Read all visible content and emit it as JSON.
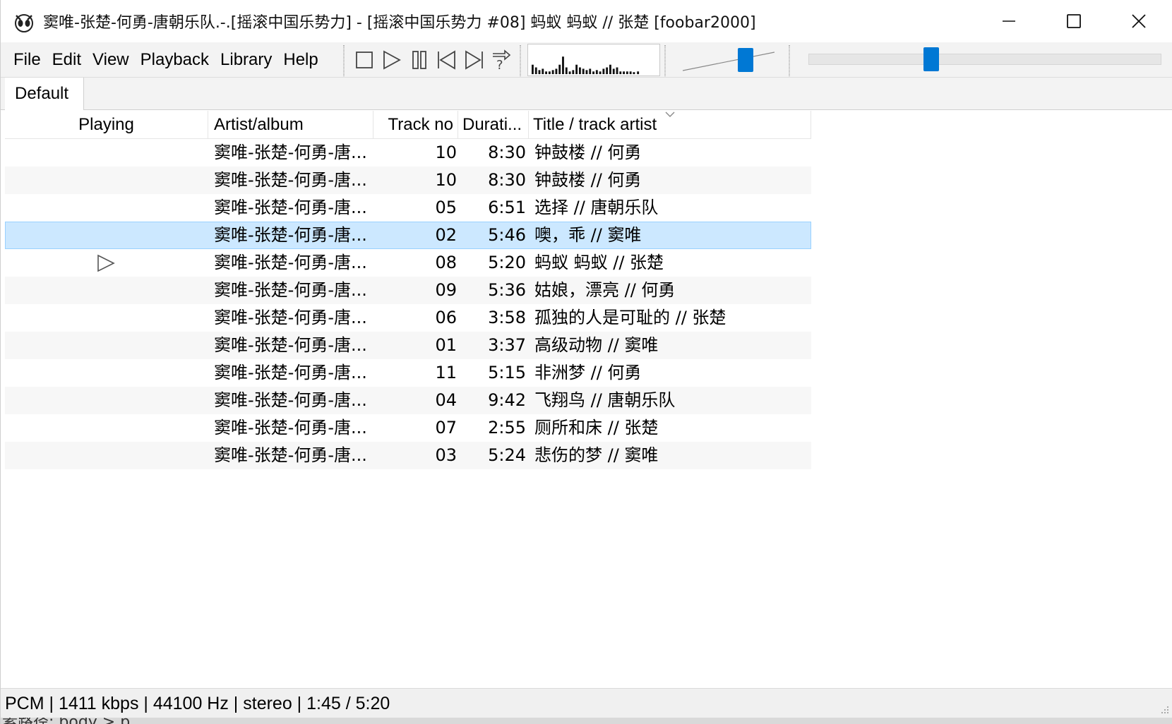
{
  "window": {
    "title": "窦唯-张楚-何勇-唐朝乐队.-.[摇滚中国乐势力] - [摇滚中国乐势力 #08] 蚂蚁 蚂蚁 // 张楚  [foobar2000]"
  },
  "menu": [
    "File",
    "Edit",
    "View",
    "Playback",
    "Library",
    "Help"
  ],
  "toolbar_icons": [
    "stop-icon",
    "play-icon",
    "pause-icon",
    "previous-icon",
    "next-icon",
    "random-icon"
  ],
  "playlist_tab": "Default",
  "columns": {
    "playing": "Playing",
    "artist": "Artist/album",
    "track": "Track no",
    "duration": "Durati...",
    "title": "Title / track artist"
  },
  "rows": [
    {
      "artist": "窦唯-张楚-何勇-唐...",
      "track": "10",
      "duration": "8:30",
      "title": "钟鼓楼 // 何勇"
    },
    {
      "artist": "窦唯-张楚-何勇-唐...",
      "track": "10",
      "duration": "8:30",
      "title": "钟鼓楼 // 何勇"
    },
    {
      "artist": "窦唯-张楚-何勇-唐...",
      "track": "05",
      "duration": "6:51",
      "title": "选择 // 唐朝乐队"
    },
    {
      "artist": "窦唯-张楚-何勇-唐...",
      "track": "02",
      "duration": "5:46",
      "title": "噢，乖 // 窦唯"
    },
    {
      "artist": "窦唯-张楚-何勇-唐...",
      "track": "08",
      "duration": "5:20",
      "title": "蚂蚁 蚂蚁 // 张楚"
    },
    {
      "artist": "窦唯-张楚-何勇-唐...",
      "track": "09",
      "duration": "5:36",
      "title": "姑娘，漂亮 // 何勇"
    },
    {
      "artist": "窦唯-张楚-何勇-唐...",
      "track": "06",
      "duration": "3:58",
      "title": "孤独的人是可耻的 // 张楚"
    },
    {
      "artist": "窦唯-张楚-何勇-唐...",
      "track": "01",
      "duration": "3:37",
      "title": "高级动物 // 窦唯"
    },
    {
      "artist": "窦唯-张楚-何勇-唐...",
      "track": "11",
      "duration": "5:15",
      "title": "非洲梦 // 何勇"
    },
    {
      "artist": "窦唯-张楚-何勇-唐...",
      "track": "04",
      "duration": "9:42",
      "title": "飞翔鸟 // 唐朝乐队"
    },
    {
      "artist": "窦唯-张楚-何勇-唐...",
      "track": "07",
      "duration": "2:55",
      "title": "厕所和床 // 张楚"
    },
    {
      "artist": "窦唯-张楚-何勇-唐...",
      "track": "03",
      "duration": "5:24",
      "title": "悲伤的梦 // 窦唯"
    }
  ],
  "selected_row": 3,
  "playing_row": 4,
  "status": "PCM | 1411 kbps | 44100 Hz | stereo | 1:45 / 5:20",
  "seek_fraction": 0.34,
  "volume_fraction": 0.72,
  "bottom_text": "素路径: body > p",
  "colors": {
    "accent": "#0078d4",
    "selection": "#cce8ff"
  }
}
